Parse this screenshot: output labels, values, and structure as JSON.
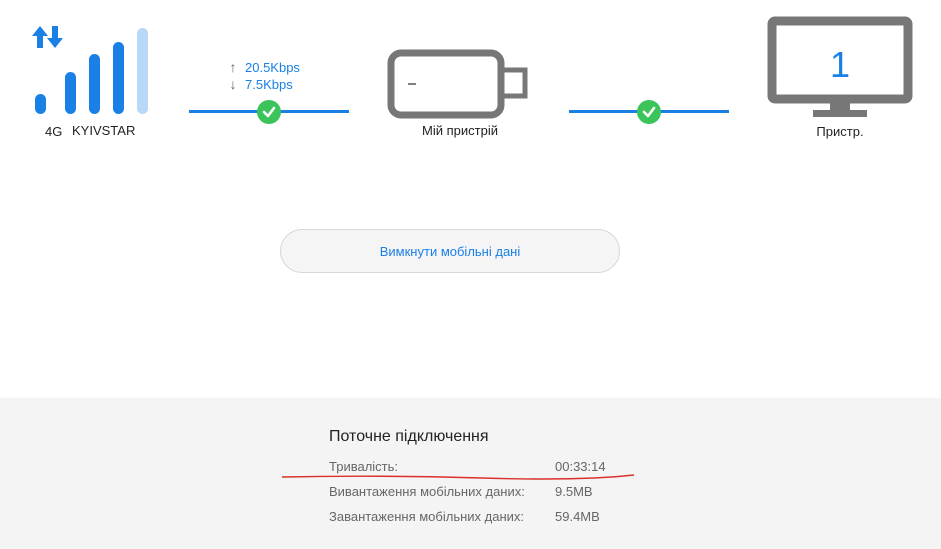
{
  "signal": {
    "network_type": "4G",
    "carrier": "KYIVSTAR",
    "bars_active": 4,
    "bars_total": 5
  },
  "traffic": {
    "upload": "20.5Kbps",
    "download": "7.5Kbps"
  },
  "device": {
    "label": "Мій пристрій"
  },
  "devices": {
    "count": "1",
    "label": "Пристр."
  },
  "actions": {
    "toggle_mobile_data": "Вимкнути мобільні дані"
  },
  "current_connection": {
    "title": "Поточне підключення",
    "rows": [
      {
        "label": "Тривалість:",
        "value": "00:33:14"
      },
      {
        "label": "Вивантаження мобільних даних:",
        "value": "9.5MB"
      },
      {
        "label": "Завантаження мобільних даних:",
        "value": "59.4MB"
      }
    ]
  },
  "colors": {
    "accent": "#1a80e6",
    "accent_light": "#b8d8f7",
    "ok_green": "#3bc45a",
    "device_gray": "#777777",
    "annotation_red": "#d9302a"
  }
}
